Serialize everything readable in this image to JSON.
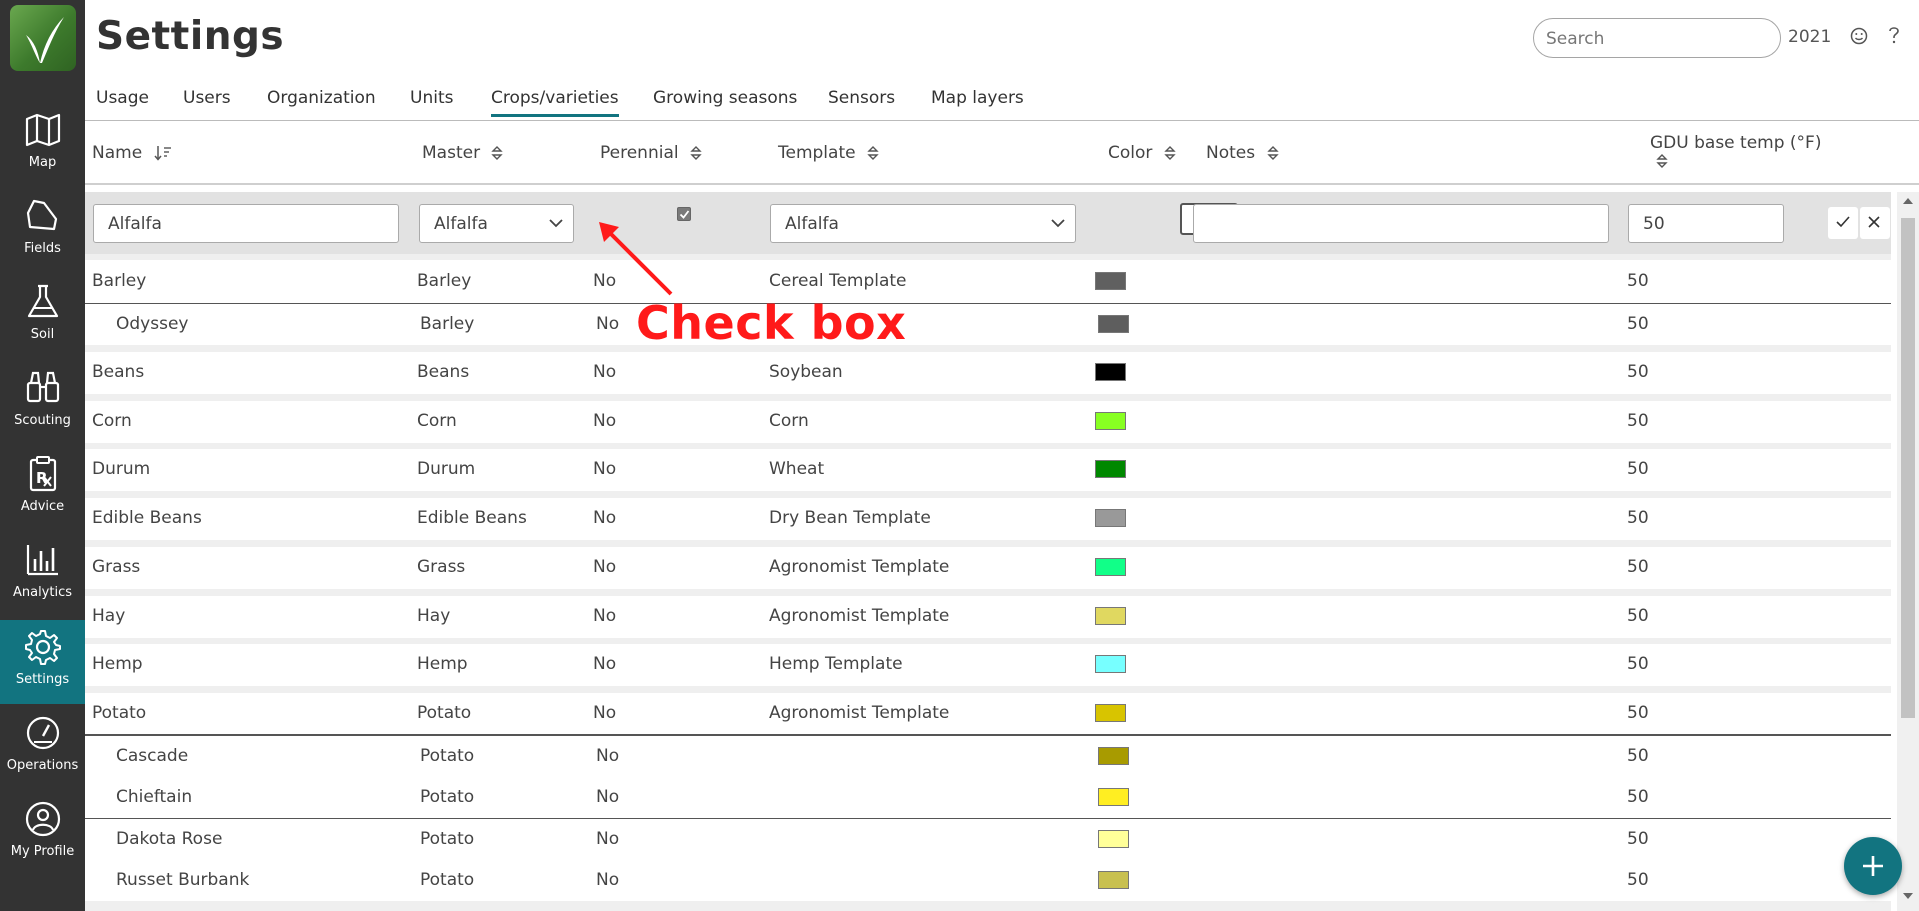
{
  "app": {
    "logo_name": "leaf-logo"
  },
  "sidebar": {
    "items": [
      {
        "label": "Map",
        "icon": "map-icon"
      },
      {
        "label": "Fields",
        "icon": "field-icon"
      },
      {
        "label": "Soil",
        "icon": "flask-icon"
      },
      {
        "label": "Scouting",
        "icon": "binoculars-icon"
      },
      {
        "label": "Advice",
        "icon": "prescription-icon"
      },
      {
        "label": "Analytics",
        "icon": "bar-chart-icon"
      },
      {
        "label": "Settings",
        "icon": "gear-icon",
        "active": true
      },
      {
        "label": "Operations",
        "icon": "gauge-icon"
      },
      {
        "label": "My Profile",
        "icon": "user-icon"
      }
    ]
  },
  "header": {
    "title": "Settings",
    "search_placeholder": "Search",
    "year": "2021"
  },
  "tabs": [
    {
      "label": "Usage"
    },
    {
      "label": "Users"
    },
    {
      "label": "Organization"
    },
    {
      "label": "Units"
    },
    {
      "label": "Crops/varieties",
      "active": true
    },
    {
      "label": "Growing seasons"
    },
    {
      "label": "Sensors"
    },
    {
      "label": "Map layers"
    }
  ],
  "columns": {
    "name": "Name",
    "master": "Master",
    "perennial": "Perennial",
    "template": "Template",
    "color": "Color",
    "notes": "Notes",
    "gdu": "GDU base temp (°F)"
  },
  "edit_row": {
    "name": "Alfalfa",
    "master": "Alfalfa",
    "perennial_checked": true,
    "template": "Alfalfa",
    "color": "#ffffff",
    "notes": "",
    "gdu": "50"
  },
  "annotation": {
    "text": "Check box",
    "color": "#ff1a1a"
  },
  "rows": [
    {
      "name": "Barley",
      "master": "Barley",
      "perennial": "No",
      "template": "Cereal Template",
      "color": "#606060",
      "gdu": "50",
      "variety": false
    },
    {
      "name": "Odyssey",
      "master": "Barley",
      "perennial": "No",
      "template": "",
      "color": "#5e5e5e",
      "gdu": "50",
      "variety": true
    },
    {
      "name": "Beans",
      "master": "Beans",
      "perennial": "No",
      "template": "Soybean",
      "color": "#000000",
      "gdu": "50",
      "variety": false
    },
    {
      "name": "Corn",
      "master": "Corn",
      "perennial": "No",
      "template": "Corn",
      "color": "#88ff22",
      "gdu": "50",
      "variety": false
    },
    {
      "name": "Durum",
      "master": "Durum",
      "perennial": "No",
      "template": "Wheat",
      "color": "#008800",
      "gdu": "50",
      "variety": false
    },
    {
      "name": "Edible Beans",
      "master": "Edible Beans",
      "perennial": "No",
      "template": "Dry Bean Template",
      "color": "#999999",
      "gdu": "50",
      "variety": false
    },
    {
      "name": "Grass",
      "master": "Grass",
      "perennial": "No",
      "template": "Agronomist Template",
      "color": "#11ff88",
      "gdu": "50",
      "variety": false
    },
    {
      "name": "Hay",
      "master": "Hay",
      "perennial": "No",
      "template": "Agronomist Template",
      "color": "#e0d860",
      "gdu": "50",
      "variety": false
    },
    {
      "name": "Hemp",
      "master": "Hemp",
      "perennial": "No",
      "template": "Hemp Template",
      "color": "#77ffff",
      "gdu": "50",
      "variety": false
    },
    {
      "name": "Potato",
      "master": "Potato",
      "perennial": "No",
      "template": "Agronomist Template",
      "color": "#d8c400",
      "gdu": "50",
      "variety": false
    },
    {
      "name": "Cascade",
      "master": "Potato",
      "perennial": "No",
      "template": "",
      "color": "#a89b00",
      "gdu": "50",
      "variety": true
    },
    {
      "name": "Chieftain",
      "master": "Potato",
      "perennial": "No",
      "template": "",
      "color": "#ffee22",
      "gdu": "50",
      "variety": true
    },
    {
      "name": "Dakota Rose",
      "master": "Potato",
      "perennial": "No",
      "template": "",
      "color": "#ffff99",
      "gdu": "50",
      "variety": true
    },
    {
      "name": "Russet Burbank",
      "master": "Potato",
      "perennial": "No",
      "template": "",
      "color": "#c8c050",
      "gdu": "50",
      "variety": true
    }
  ]
}
